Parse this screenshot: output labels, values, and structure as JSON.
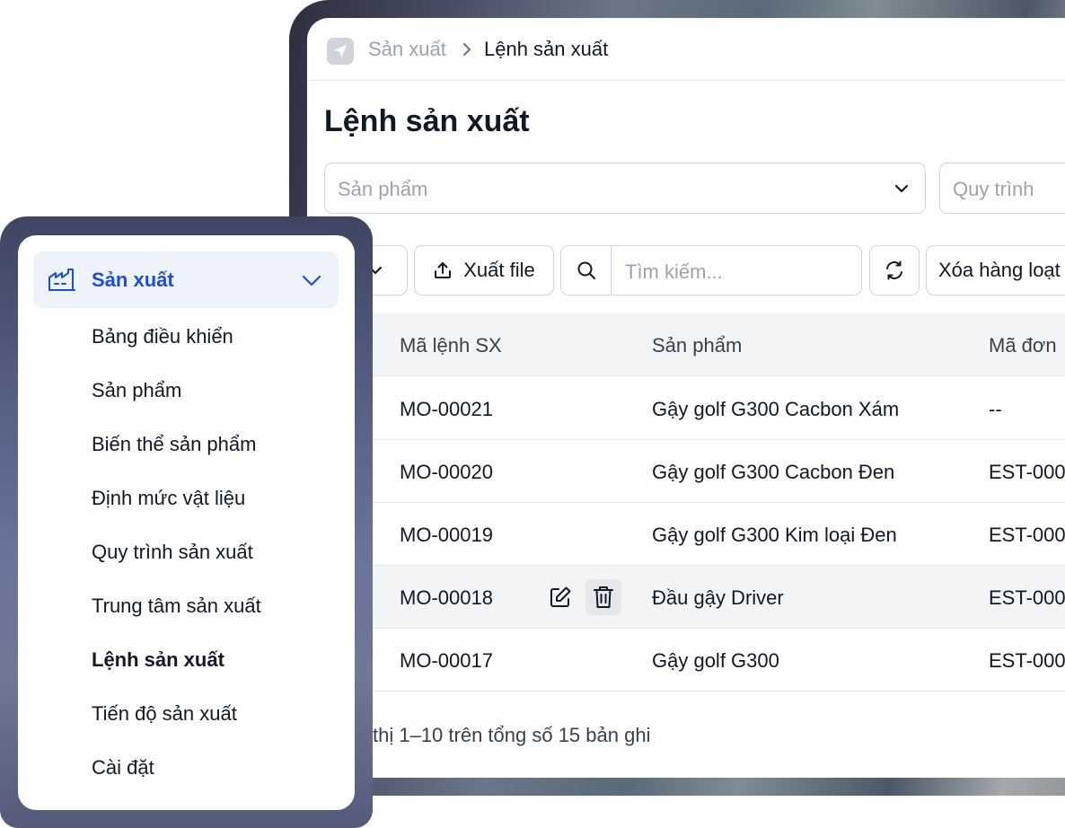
{
  "breadcrumb": {
    "parent": "Sản xuất",
    "current": "Lệnh sản xuất"
  },
  "page": {
    "title": "Lệnh sản xuất"
  },
  "filters": {
    "product_placeholder": "Sản phẩm",
    "process_placeholder": "Quy trình"
  },
  "toolbar": {
    "export_label": "Xuất file",
    "search_placeholder": "Tìm kiếm...",
    "bulk_delete_label": "Xóa hàng loạt"
  },
  "table": {
    "headers": [
      "Mã lệnh SX",
      "Sản phẩm",
      "Mã đơn"
    ],
    "rows": [
      {
        "code": "MO-00021",
        "product": "Gậy golf G300 Cacbon Xám",
        "order": "--"
      },
      {
        "code": "MO-00020",
        "product": "Gậy golf G300 Cacbon Đen",
        "order": "EST-000"
      },
      {
        "code": "MO-00019",
        "product": "Gậy golf G300 Kim loại Đen",
        "order": "EST-000"
      },
      {
        "code": "MO-00018",
        "product": "Đầu gậy Driver",
        "order": "EST-000"
      },
      {
        "code": "MO-00017",
        "product": "Gậy golf G300",
        "order": "EST-000"
      }
    ]
  },
  "pagination": {
    "summary": "thị 1–10 trên tổng số 15 bản ghi"
  },
  "sidebar": {
    "group_label": "Sản xuất",
    "group_icon": "factory-icon",
    "items": [
      {
        "label": "Bảng điều khiển"
      },
      {
        "label": "Sản phẩm"
      },
      {
        "label": "Biến thể sản phẩm"
      },
      {
        "label": "Định mức vật liệu"
      },
      {
        "label": "Quy trình sản xuất"
      },
      {
        "label": "Trung tâm sản xuất"
      },
      {
        "label": "Lệnh sản xuất"
      },
      {
        "label": "Tiến độ sản xuất"
      },
      {
        "label": "Cài đặt"
      }
    ]
  },
  "colors": {
    "accent": "#1d4ed8",
    "highlight_bg": "#eef2fb",
    "border": "#d1d5db"
  }
}
